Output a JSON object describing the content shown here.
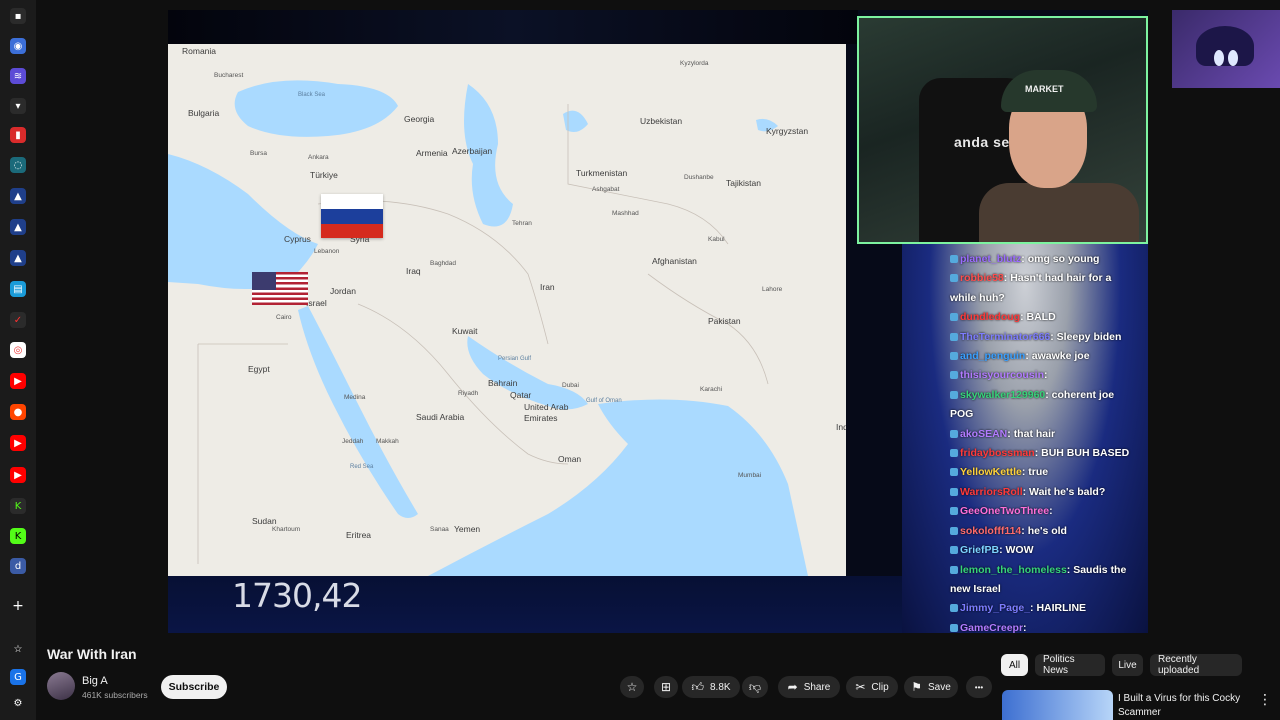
{
  "video": {
    "ticker_value": "1730,42",
    "cam_brand": "anda seaT",
    "cam_hat_text": "MARKET",
    "map_labels": {
      "romania": "Romania",
      "bucharest": "Bucharest",
      "black_sea": "Black Sea",
      "georgia": "Georgia",
      "bulgaria": "Bulgaria",
      "armenia": "Armenia",
      "azerbaijan": "Azerbaijan",
      "bursa": "Bursa",
      "ankara": "Ankara",
      "turkiye": "Türkiye",
      "uzbekistan": "Uzbekistan",
      "kyrgyzstan": "Kyrgyzstan",
      "turkmenistan": "Turkmenistan",
      "ashgabat": "Ashgabat",
      "tajikistan": "Tajikistan",
      "dushanbe": "Dushanbe",
      "tehran": "Tehran",
      "mashhad": "Mashhad",
      "cyprus": "Cyprus",
      "syria": "Syria",
      "lebanon": "Lebanon",
      "iraq": "Iraq",
      "baghdad": "Baghdad",
      "afghanistan": "Afghanistan",
      "kabul": "Kabul",
      "iran": "Iran",
      "israel": "Israel",
      "jordan": "Jordan",
      "lahore": "Lahore",
      "pakistan": "Pakistan",
      "kuwait": "Kuwait",
      "egypt": "Egypt",
      "cairo": "Cairo",
      "persian_gulf": "Persian Gulf",
      "bahrain": "Bahrain",
      "qatar": "Qatar",
      "riyadh": "Riyadh",
      "dubai": "Dubai",
      "karachi": "Karachi",
      "saudi_arabia": "Saudi Arabia",
      "uae": "United Arab Emirates",
      "gulf_of_oman": "Gulf of Oman",
      "medina": "Medina",
      "jeddah": "Jeddah",
      "makkah": "Makkah",
      "red_sea": "Red Sea",
      "oman": "Oman",
      "mumbai": "Mumbai",
      "sudan": "Sudan",
      "khartoum": "Khartoum",
      "eritrea": "Eritrea",
      "sanaa": "Sanaa",
      "yemen": "Yemen",
      "india_edge": "Ind",
      "kyzylorda": "Kyzylorda"
    }
  },
  "chat": {
    "messages": [
      {
        "user": "planet_blutz",
        "text": "omg so young",
        "color": "#9b6cff"
      },
      {
        "user": "robbie58",
        "text": "Hasn't had hair for a while huh?",
        "color": "#ff4d4d"
      },
      {
        "user": "dundledoug",
        "text": "BALD",
        "color": "#ff3a3a"
      },
      {
        "user": "TheTerminator666",
        "text": "Sleepy biden",
        "color": "#7d7dff"
      },
      {
        "user": "and_penguin",
        "text": "awawke joe",
        "color": "#3aa0ff"
      },
      {
        "user": "thisisyourcousin",
        "text": "",
        "color": "#b27bff"
      },
      {
        "user": "skywalker129960",
        "text": "coherent joe POG",
        "color": "#37d37a"
      },
      {
        "user": "akoSEAN",
        "text": "that hair",
        "color": "#b27bff"
      },
      {
        "user": "fridaybossman",
        "text": "BUH BUH BASED",
        "color": "#ff3a3a"
      },
      {
        "user": "YellowKettle",
        "text": "true",
        "color": "#ffd23a"
      },
      {
        "user": "WarriorsRoll",
        "text": "Wait he's bald?",
        "color": "#ff3a3a"
      },
      {
        "user": "GeeOneTwoThree",
        "text": "",
        "color": "#ff6fd8"
      },
      {
        "user": "sokolofff114",
        "text": "he's old",
        "color": "#ff6b6b"
      },
      {
        "user": "GriefPB",
        "text": "WOW",
        "color": "#7dd3ff"
      },
      {
        "user": "lemon_the_homeless",
        "text": "Saudis the new Israel",
        "color": "#37d37a"
      },
      {
        "user": "Jimmy_Page_",
        "text": "HAIRLINE",
        "color": "#7d7dff"
      },
      {
        "user": "GameCreepr",
        "text": "",
        "color": "#b27bff"
      }
    ]
  },
  "info": {
    "title": "War With Iran",
    "channel": "Big A",
    "subscribers": "461K subscribers",
    "subscribe_label": "Subscribe",
    "likes": "8.8K",
    "share": "Share",
    "clip": "Clip",
    "save": "Save",
    "more": "•••"
  },
  "chips": [
    "All",
    "Politics News",
    "Live",
    "Recently uploaded"
  ],
  "recommended": {
    "title": "I Built a Virus for this Cocky Scammer"
  },
  "colors": {
    "map_water": "#aadaff",
    "map_land": "#eeece6",
    "chat_overlay": "#1a2b80",
    "cam_border": "#7df3a0"
  }
}
